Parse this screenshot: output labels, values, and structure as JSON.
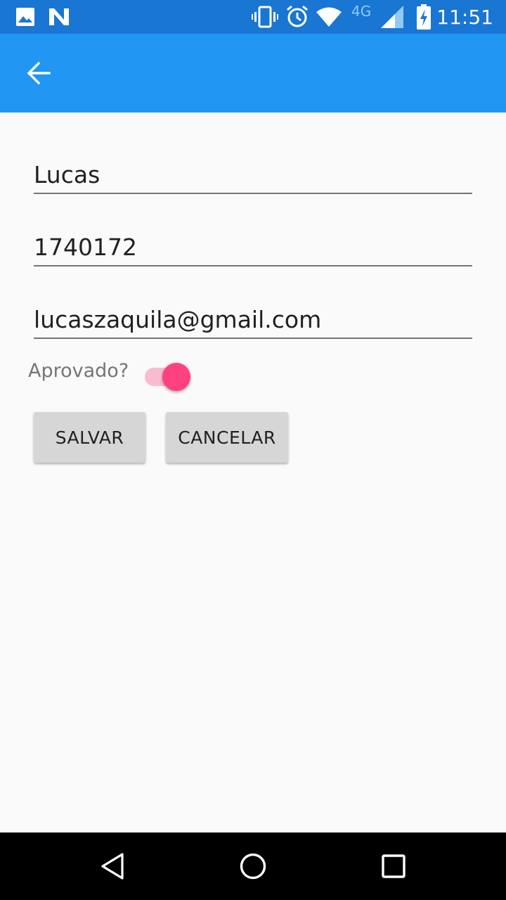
{
  "status_bar": {
    "time": "11:51",
    "network": "4G",
    "icons": [
      "image-icon",
      "n-icon",
      "vibrate-icon",
      "alarm-icon",
      "wifi-icon",
      "signal-icon",
      "battery-charging-icon"
    ]
  },
  "app_bar": {
    "back_icon": "arrow-back-icon"
  },
  "form": {
    "name": "Lucas",
    "registration": "1740172",
    "email": "lucaszaquila@gmail.com",
    "approved_label": "Aprovado?",
    "approved": true
  },
  "buttons": {
    "save": "SALVAR",
    "cancel": "CANCELAR"
  },
  "nav_bar": {
    "icons": [
      "back-triangle-icon",
      "home-circle-icon",
      "recents-square-icon"
    ]
  },
  "colors": {
    "status_bar": "#1976d2",
    "app_bar": "#2196f3",
    "accent": "#ff4081",
    "accent_track": "#f8bbd0",
    "button": "#d6d6d6",
    "background": "#fafafa"
  }
}
